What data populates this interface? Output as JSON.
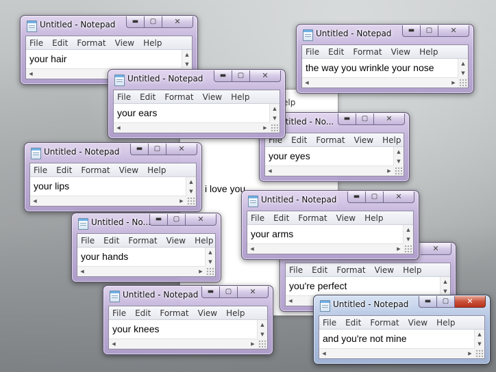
{
  "background_text": "i love you",
  "background_menu_peek": "elp",
  "window_title": "Untitled - Notepad",
  "window_title_truncated_1": "Untitled - No...",
  "window_title_truncated_2": "ntitled - No...",
  "menu": [
    "File",
    "Edit",
    "Format",
    "View",
    "Help"
  ],
  "captions": {
    "minimize": "▬",
    "maximize": "▢",
    "close": "✕"
  },
  "windows": [
    {
      "id": "hair",
      "text": "your hair"
    },
    {
      "id": "nose",
      "text": "the way you wrinkle your nose"
    },
    {
      "id": "ears",
      "text": "your ears"
    },
    {
      "id": "eyes",
      "text": "your eyes"
    },
    {
      "id": "lips",
      "text": "your lips"
    },
    {
      "id": "arms",
      "text": "your arms"
    },
    {
      "id": "hands",
      "text": "your hands"
    },
    {
      "id": "perfect",
      "text": "you're perfect"
    },
    {
      "id": "knees",
      "text": "your knees"
    },
    {
      "id": "notmine",
      "text": "and you're not mine"
    }
  ]
}
